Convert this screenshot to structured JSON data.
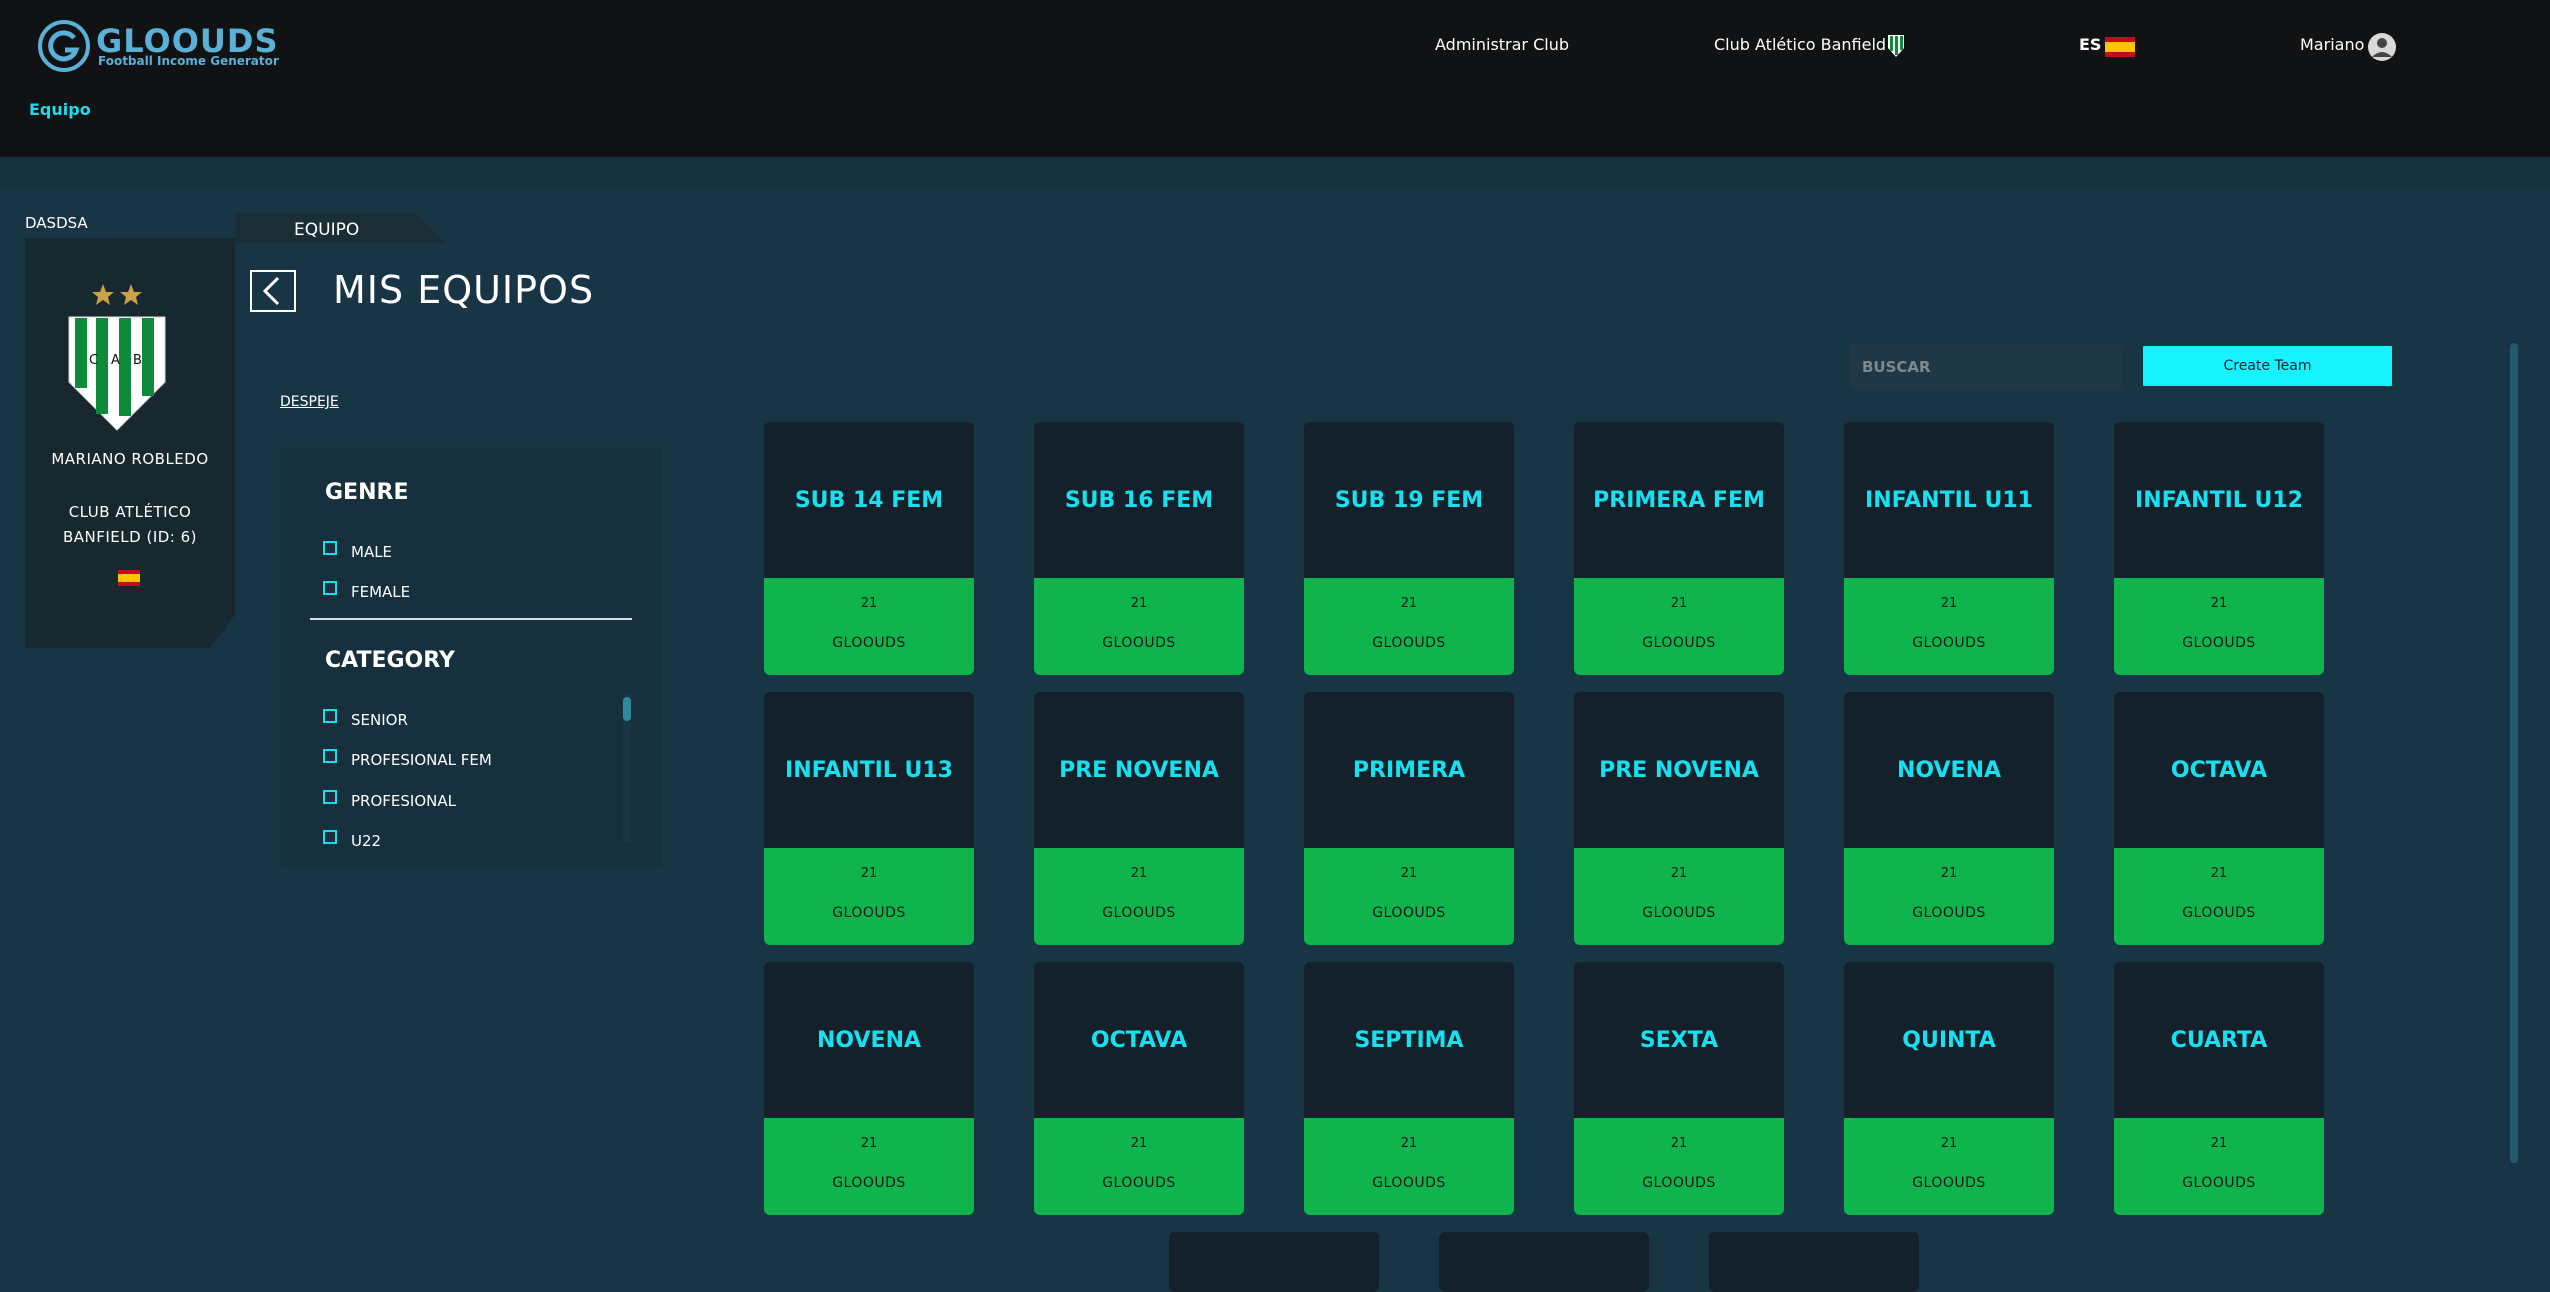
{
  "header": {
    "logo_text": "GLOOUDS",
    "logo_tagline": "Football Income Generator",
    "nav": {
      "admin_label": "Administrar Club",
      "club_label": "Club Atlético Banfield",
      "language": "ES",
      "user": "Mariano"
    },
    "section_label": "Equipo"
  },
  "profile": {
    "tag": "DASDSA",
    "name": "MARIANO ROBLEDO",
    "club": "CLUB ATLÉTICO BANFIELD (ID: 6)",
    "crest_letters": [
      "C",
      "A",
      "B"
    ],
    "colors": {
      "crest_green": "#0f8a3c",
      "star": "#c9a24a"
    }
  },
  "main": {
    "tab": "EQUIPO",
    "title": "MIS EQUIPOS",
    "clear_filters": "DESPEJE",
    "search_placeholder": "BUSCAR",
    "create_button": "Create Team"
  },
  "filters": {
    "genre_title": "GENRE",
    "genre_options": [
      "MALE",
      "FEMALE"
    ],
    "category_title": "CATEGORY",
    "category_options": [
      "SENIOR",
      "PROFESIONAL FEM",
      "PROFESIONAL",
      "U22"
    ]
  },
  "teams": [
    {
      "name": "SUB 14 FEM",
      "count": "21",
      "brand": "GLOOUDS"
    },
    {
      "name": "SUB 16 FEM",
      "count": "21",
      "brand": "GLOOUDS"
    },
    {
      "name": "SUB 19 FEM",
      "count": "21",
      "brand": "GLOOUDS"
    },
    {
      "name": "PRIMERA FEM",
      "count": "21",
      "brand": "GLOOUDS"
    },
    {
      "name": "INFANTIL U11",
      "count": "21",
      "brand": "GLOOUDS"
    },
    {
      "name": "INFANTIL U12",
      "count": "21",
      "brand": "GLOOUDS"
    },
    {
      "name": "INFANTIL U13",
      "count": "21",
      "brand": "GLOOUDS"
    },
    {
      "name": "PRE NOVENA",
      "count": "21",
      "brand": "GLOOUDS"
    },
    {
      "name": "PRIMERA",
      "count": "21",
      "brand": "GLOOUDS"
    },
    {
      "name": "PRE NOVENA",
      "count": "21",
      "brand": "GLOOUDS"
    },
    {
      "name": "NOVENA",
      "count": "21",
      "brand": "GLOOUDS"
    },
    {
      "name": "OCTAVA",
      "count": "21",
      "brand": "GLOOUDS"
    },
    {
      "name": "NOVENA",
      "count": "21",
      "brand": "GLOOUDS"
    },
    {
      "name": "OCTAVA",
      "count": "21",
      "brand": "GLOOUDS"
    },
    {
      "name": "SEPTIMA",
      "count": "21",
      "brand": "GLOOUDS"
    },
    {
      "name": "SEXTA",
      "count": "21",
      "brand": "GLOOUDS"
    },
    {
      "name": "QUINTA",
      "count": "21",
      "brand": "GLOOUDS"
    },
    {
      "name": "CUARTA",
      "count": "21",
      "brand": "GLOOUDS"
    }
  ],
  "icons": {
    "back": "chevron-left-icon",
    "user": "user-avatar-icon",
    "flag": "spain-flag-icon",
    "club": "club-crest-icon"
  },
  "colors": {
    "accent": "#16f2ff",
    "card_green": "#0fb54c",
    "page_bg": "#183546",
    "header_bg": "#101213"
  }
}
